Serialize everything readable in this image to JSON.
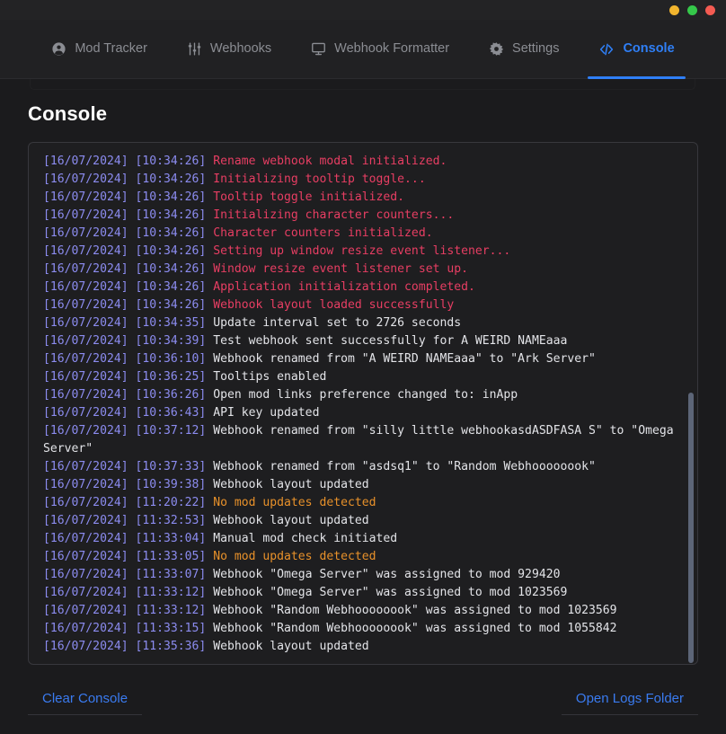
{
  "window": {
    "controls": [
      {
        "name": "minimize",
        "color": "#f2b52e"
      },
      {
        "name": "maximize",
        "color": "#35c84a"
      },
      {
        "name": "close",
        "color": "#f45b52"
      }
    ]
  },
  "tabs": [
    {
      "id": "mod-tracker",
      "label": "Mod Tracker",
      "icon": "user-circle-icon",
      "active": false
    },
    {
      "id": "webhooks",
      "label": "Webhooks",
      "icon": "sliders-icon",
      "active": false
    },
    {
      "id": "webhook-formatter",
      "label": "Webhook Formatter",
      "icon": "monitor-icon",
      "active": false
    },
    {
      "id": "settings",
      "label": "Settings",
      "icon": "gear-icon",
      "active": false
    },
    {
      "id": "console",
      "label": "Console",
      "icon": "code-icon",
      "active": true
    }
  ],
  "page": {
    "title": "Console",
    "accent_color": "#2f7ff6"
  },
  "console": {
    "scrollbar": {
      "thumb_top_pct": 48,
      "thumb_height_pct": 52
    },
    "colors": {
      "timestamp": "#8c8cf0",
      "error": "#e83e63",
      "info": "#e3e4e8",
      "warn": "#e8912a"
    },
    "lines": [
      {
        "date": "[16/07/2024]",
        "time": "[10:34:26]",
        "message": "Rename webhook modal initialized.",
        "level": "red"
      },
      {
        "date": "[16/07/2024]",
        "time": "[10:34:26]",
        "message": "Initializing tooltip toggle...",
        "level": "red"
      },
      {
        "date": "[16/07/2024]",
        "time": "[10:34:26]",
        "message": "Tooltip toggle initialized.",
        "level": "red"
      },
      {
        "date": "[16/07/2024]",
        "time": "[10:34:26]",
        "message": "Initializing character counters...",
        "level": "red"
      },
      {
        "date": "[16/07/2024]",
        "time": "[10:34:26]",
        "message": "Character counters initialized.",
        "level": "red"
      },
      {
        "date": "[16/07/2024]",
        "time": "[10:34:26]",
        "message": "Setting up window resize event listener...",
        "level": "red"
      },
      {
        "date": "[16/07/2024]",
        "time": "[10:34:26]",
        "message": "Window resize event listener set up.",
        "level": "red"
      },
      {
        "date": "[16/07/2024]",
        "time": "[10:34:26]",
        "message": "Application initialization completed.",
        "level": "red"
      },
      {
        "date": "[16/07/2024]",
        "time": "[10:34:26]",
        "message": "Webhook layout loaded successfully",
        "level": "red"
      },
      {
        "date": "[16/07/2024]",
        "time": "[10:34:35]",
        "message": "Update interval set to 2726 seconds",
        "level": "white"
      },
      {
        "date": "[16/07/2024]",
        "time": "[10:34:39]",
        "message": "Test webhook sent successfully for A WEIRD NAMEaaa",
        "level": "white"
      },
      {
        "date": "[16/07/2024]",
        "time": "[10:36:10]",
        "message": "Webhook renamed from \"A WEIRD NAMEaaa\" to \"Ark Server\"",
        "level": "white"
      },
      {
        "date": "[16/07/2024]",
        "time": "[10:36:25]",
        "message": "Tooltips enabled",
        "level": "white"
      },
      {
        "date": "[16/07/2024]",
        "time": "[10:36:26]",
        "message": "Open mod links preference changed to: inApp",
        "level": "white"
      },
      {
        "date": "[16/07/2024]",
        "time": "[10:36:43]",
        "message": "API key updated",
        "level": "white"
      },
      {
        "date": "[16/07/2024]",
        "time": "[10:37:12]",
        "message": "Webhook renamed from \"silly little webhookasdASDFASA S\" to \"Omega Server\"",
        "level": "white"
      },
      {
        "date": "[16/07/2024]",
        "time": "[10:37:33]",
        "message": "Webhook renamed from \"asdsq1\" to \"Random Webhoooooook\"",
        "level": "white"
      },
      {
        "date": "[16/07/2024]",
        "time": "[10:39:38]",
        "message": "Webhook layout updated",
        "level": "white"
      },
      {
        "date": "[16/07/2024]",
        "time": "[11:20:22]",
        "message": "No mod updates detected",
        "level": "orange"
      },
      {
        "date": "[16/07/2024]",
        "time": "[11:32:53]",
        "message": "Webhook layout updated",
        "level": "white"
      },
      {
        "date": "[16/07/2024]",
        "time": "[11:33:04]",
        "message": "Manual mod check initiated",
        "level": "white"
      },
      {
        "date": "[16/07/2024]",
        "time": "[11:33:05]",
        "message": "No mod updates detected",
        "level": "orange"
      },
      {
        "date": "[16/07/2024]",
        "time": "[11:33:07]",
        "message": "Webhook \"Omega Server\" was assigned to mod 929420",
        "level": "white"
      },
      {
        "date": "[16/07/2024]",
        "time": "[11:33:12]",
        "message": "Webhook \"Omega Server\" was assigned to mod 1023569",
        "level": "white"
      },
      {
        "date": "[16/07/2024]",
        "time": "[11:33:12]",
        "message": "Webhook \"Random Webhoooooook\" was assigned to mod 1023569",
        "level": "white"
      },
      {
        "date": "[16/07/2024]",
        "time": "[11:33:15]",
        "message": "Webhook \"Random Webhoooooook\" was assigned to mod 1055842",
        "level": "white"
      },
      {
        "date": "[16/07/2024]",
        "time": "[11:35:36]",
        "message": "Webhook layout updated",
        "level": "white"
      }
    ]
  },
  "footer": {
    "clear_console_label": "Clear Console",
    "open_logs_label": "Open Logs Folder"
  }
}
